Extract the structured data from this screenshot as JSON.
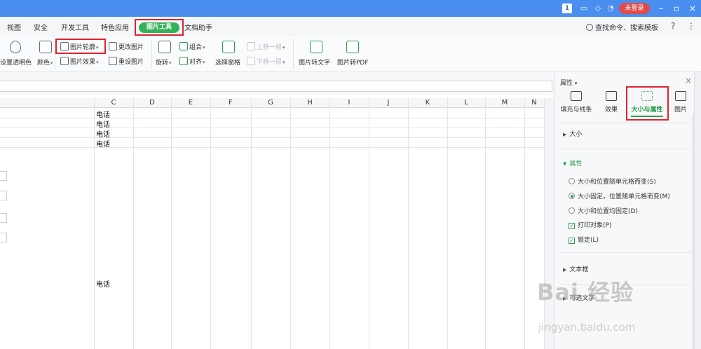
{
  "titlebar": {
    "badge": "1",
    "login_label": "未登录",
    "icons": [
      "doc-icon",
      "shirt-icon",
      "bell-icon"
    ],
    "window_controls": [
      "minimize-icon",
      "restore-icon",
      "close-icon"
    ]
  },
  "menu": {
    "tabs": [
      "视图",
      "安全",
      "开发工具",
      "特色应用",
      "图片工具",
      "文档助手"
    ],
    "search_label": "查找命令、搜索模板",
    "help_symbol": "?",
    "more_symbol": "⋮"
  },
  "ribbon": {
    "transparency": "设置透明色",
    "color": "颜色",
    "outline": "图片轮廓",
    "effects": "图片效果",
    "change_picture": "更改图片",
    "reset_picture": "重设图片",
    "rotate": "旋转",
    "group": "组合",
    "align": "对齐",
    "selection_pane": "选择窗格",
    "bring_forward": "上移一层",
    "send_backward": "下移一层",
    "to_text": "图片转文字",
    "to_pdf": "图片转PDF"
  },
  "grid": {
    "columns": [
      "C",
      "D",
      "E",
      "F",
      "G",
      "H",
      "I",
      "J",
      "K",
      "L",
      "M",
      "N"
    ],
    "cells": [
      "电话",
      "电话",
      "电话",
      "电话",
      "电话"
    ]
  },
  "panel": {
    "title": "属性",
    "tabs": [
      "填充与线条",
      "效果",
      "大小与属性",
      "图片"
    ],
    "active_tab": "大小与属性",
    "sections": {
      "size": "大小",
      "properties": "属性",
      "textbox": "文本框",
      "alt_text": "可选文字"
    },
    "options": [
      {
        "label": "大小和位置随单元格而变(S)",
        "checked": false
      },
      {
        "label": "大小固定，位置随单元格而变(M)",
        "checked": true
      },
      {
        "label": "大小和位置均固定(D)",
        "checked": false
      }
    ],
    "checks": [
      {
        "label": "打印对象(P)",
        "checked": true
      },
      {
        "label": "锁定(L)",
        "checked": true
      }
    ]
  },
  "watermark": {
    "main": "Bai 经验",
    "sub": "jingyan.baidu.com"
  },
  "colors": {
    "accent": "#35b15a",
    "highlight": "#e0242f",
    "titlebar": "#4a8ff0"
  }
}
